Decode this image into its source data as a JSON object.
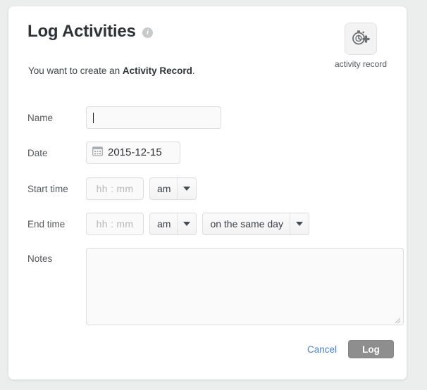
{
  "dialog": {
    "title": "Log Activities",
    "info_icon": "info-icon",
    "info_glyph": "i",
    "subtitle_prefix": "You want to create an ",
    "subtitle_strong": "Activity Record",
    "subtitle_suffix": "."
  },
  "record_badge": {
    "icon": "stopwatch-plus-icon",
    "label": "activity record"
  },
  "form": {
    "name": {
      "label": "Name",
      "value": "",
      "placeholder": ""
    },
    "date": {
      "label": "Date",
      "value": "2015-12-15",
      "icon": "calendar-icon"
    },
    "start_time": {
      "label": "Start time",
      "value": "",
      "placeholder": "hh : mm",
      "meridiem": "am"
    },
    "end_time": {
      "label": "End time",
      "value": "",
      "placeholder": "hh : mm",
      "meridiem": "am",
      "day_offset": "on the same day"
    },
    "notes": {
      "label": "Notes",
      "value": "",
      "placeholder": ""
    }
  },
  "footer": {
    "cancel_label": "Cancel",
    "submit_label": "Log"
  },
  "colors": {
    "page_background": "#eceded",
    "card_background": "#ffffff",
    "link": "#4a7fd4",
    "submit_button": "#8e8e8e",
    "label_text": "#55585c",
    "title_text": "#2f3236"
  }
}
